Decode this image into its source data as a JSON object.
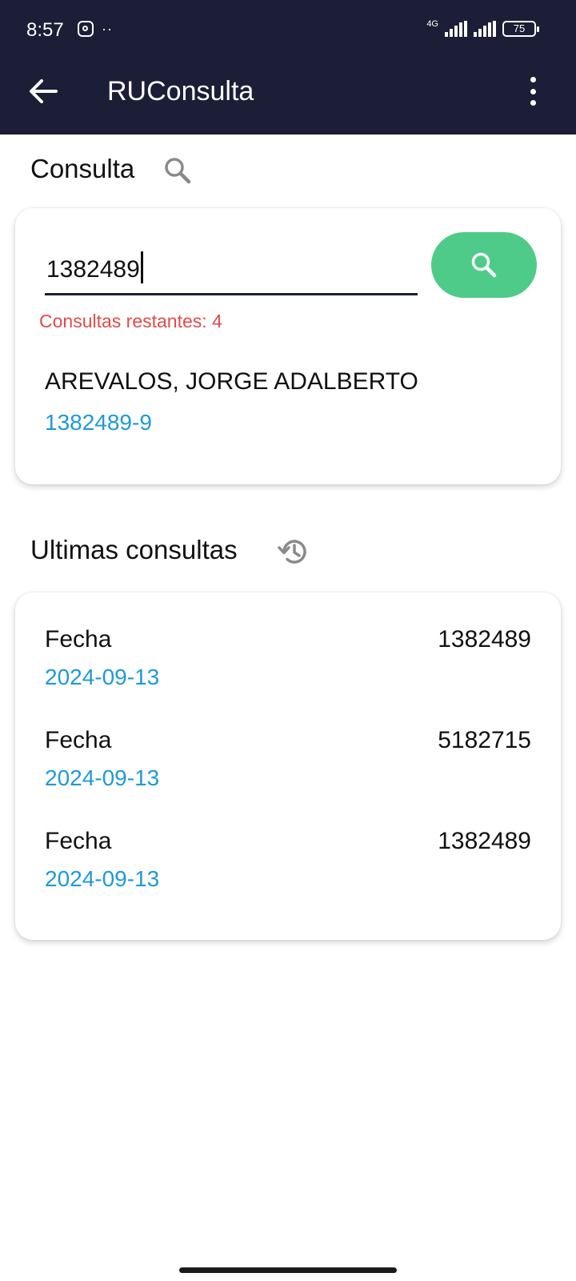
{
  "status_bar": {
    "time": "8:57",
    "network": "4G",
    "battery": "75"
  },
  "appbar": {
    "title": "RUConsulta",
    "back_icon": "arrow-left-icon",
    "menu_icon": "more-vert-icon"
  },
  "consulta": {
    "section_title": "Consulta",
    "section_icon": "search-icon",
    "input_value": "1382489",
    "search_button_icon": "search-icon",
    "remaining_text": "Consultas restantes: 4",
    "result": {
      "name": "AREVALOS, JORGE ADALBERTO",
      "ruc": "1382489-9"
    }
  },
  "history": {
    "section_title": "Ultimas consultas",
    "section_icon": "history-icon",
    "items": [
      {
        "label": "Fecha",
        "date": "2024-09-13",
        "number": "1382489"
      },
      {
        "label": "Fecha",
        "date": "2024-09-13",
        "number": "5182715"
      },
      {
        "label": "Fecha",
        "date": "2024-09-13",
        "number": "1382489"
      }
    ]
  },
  "colors": {
    "appbar": "#1b1e36",
    "accent_green": "#4ecb88",
    "link_blue": "#1f9ad6",
    "error_red": "#e24a4a"
  }
}
